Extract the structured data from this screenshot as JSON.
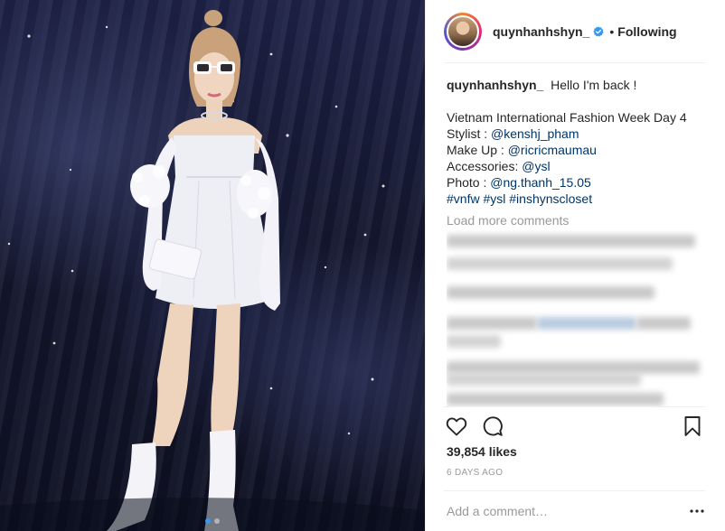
{
  "post": {
    "username": "quynhanhshyn_",
    "follow_status": "Following",
    "caption": {
      "first_line": "Hello I'm back !",
      "line_event": "Vietnam International Fashion Week Day 4",
      "stylist_label": "Stylist : ",
      "stylist_handle": "@kenshj_pham",
      "makeup_label": "Make Up : ",
      "makeup_handle": "@ricricmaumau",
      "accessories_label": "Accessories: ",
      "accessories_handle": "@ysl",
      "photo_label": "Photo : ",
      "photo_handle": "@ng.thanh_15.05",
      "hashtags": [
        "#vnfw",
        "#ysl",
        "#inshynscloset"
      ]
    },
    "load_more": "Load more comments",
    "likes": "39,854 likes",
    "timestamp": "6 DAYS AGO",
    "comment_placeholder": "Add a comment…"
  },
  "carousel": {
    "current": 1,
    "total": 2
  },
  "icons": {
    "like": "heart-icon",
    "comment": "comment-icon",
    "save": "bookmark-icon",
    "verified": "verified-badge-icon",
    "more": "more-options-icon"
  },
  "colors": {
    "link": "#003569",
    "verified": "#3897f0",
    "muted": "#999999",
    "text": "#262626"
  }
}
